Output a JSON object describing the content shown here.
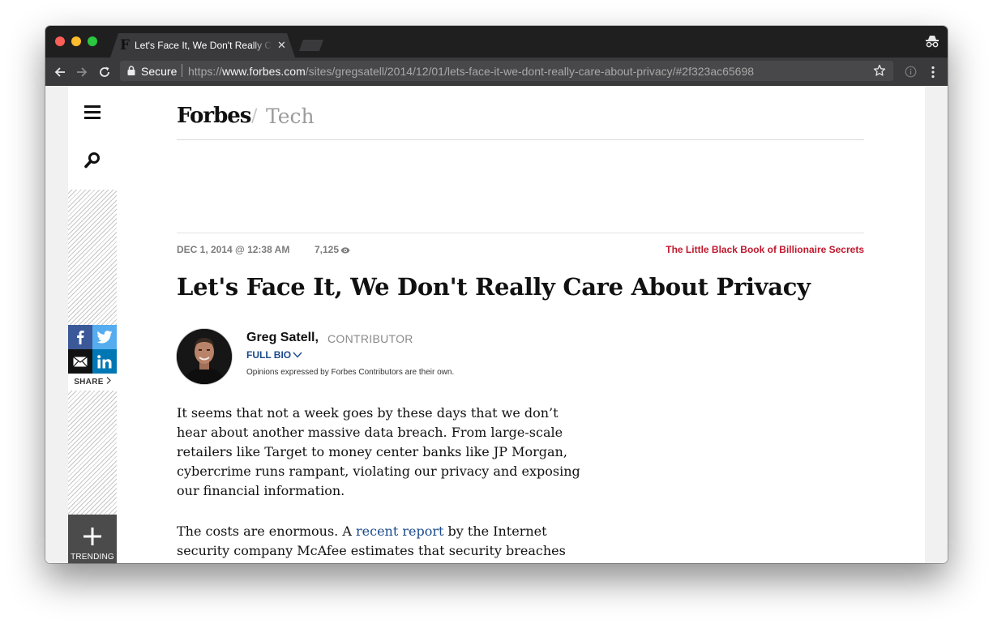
{
  "browser": {
    "tab": {
      "favicon": "F",
      "title": "Let's Face It, We Don't Really Care About Privacy",
      "close": "✕"
    },
    "address": {
      "secure_label": "Secure",
      "url_scheme": "https://",
      "url_host": "www.forbes.com",
      "url_path": "/sites/gregsatell/2014/12/01/lets-face-it-we-dont-really-care-about-privacy/#2f323ac65698"
    },
    "icons": [
      "back-arrow-icon",
      "forward-arrow-icon",
      "reload-icon",
      "lock-icon",
      "star-icon",
      "info-icon",
      "more-menu-icon",
      "incognito-icon"
    ]
  },
  "sidebar": {
    "share_label": "SHARE",
    "trending_label": "TRENDING",
    "share_buttons": [
      "facebook",
      "twitter",
      "email",
      "linkedin"
    ]
  },
  "masthead": {
    "brand": "Forbes",
    "separator": "/",
    "section": "Tech"
  },
  "article": {
    "date": "DEC 1, 2014 @ 12:38 AM",
    "views": "7,125",
    "promo": "The Little Black Book of Billionaire Secrets",
    "headline": "Let's Face It, We Don't Really Care About Privacy",
    "author": {
      "name": "Greg Satell",
      "role": "CONTRIBUTOR",
      "full_bio": "FULL BIO",
      "disclaimer": "Opinions expressed by Forbes Contributors are their own."
    },
    "paragraph1": "It seems that not a week goes by these days that we don’t hear about another massive data breach.  From large-scale retailers like Target to money center banks like JP Morgan, cybercrime runs rampant, violating our privacy and exposing our financial information.",
    "paragraph2_start": "The costs are enormous.  A ",
    "paragraph2_link": "recent report",
    "paragraph2_end": " by the Internet security company McAfee estimates that security breaches cost us over"
  },
  "colors": {
    "promo_red": "#c0182d",
    "link_blue": "#1a4a8c",
    "facebook": "#3b5998",
    "twitter": "#55acee",
    "email": "#111111",
    "linkedin": "#0077b5"
  }
}
